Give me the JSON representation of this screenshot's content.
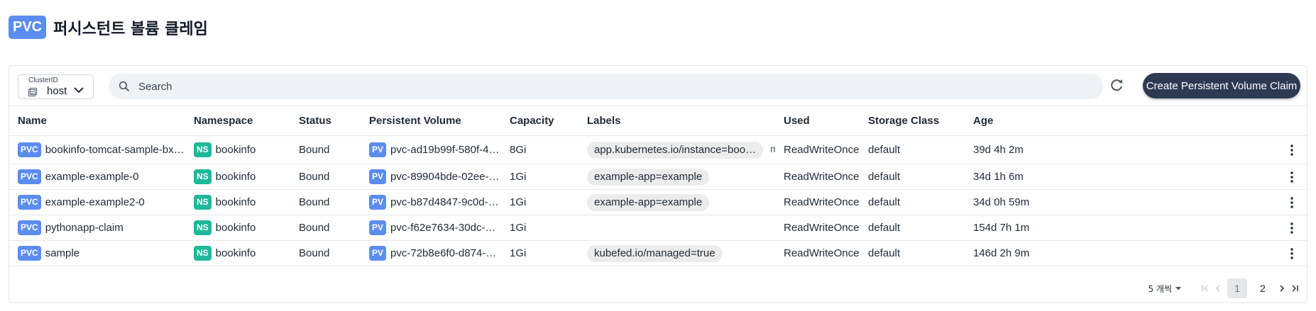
{
  "header": {
    "logo_text": "PVC",
    "title": "퍼시스턴트 볼륨 클레임"
  },
  "toolbar": {
    "cluster_caption": "ClusterID",
    "cluster_value": "host",
    "search_placeholder": "Search",
    "search_value": "",
    "create_label": "Create Persistent Volume Claim"
  },
  "table": {
    "columns": [
      "Name",
      "Namespace",
      "Status",
      "Persistent Volume",
      "Capacity",
      "Labels",
      "Used",
      "Storage Class",
      "Age"
    ],
    "rows": [
      {
        "name_tag": "PVC",
        "name": "bookinfo-tomcat-sample-bxc…",
        "ns_tag": "NS",
        "namespace": "bookinfo",
        "status": "Bound",
        "pv_tag": "PV",
        "pv": "pvc-ad19b99f-580f-494…",
        "capacity": "8Gi",
        "label": "app.kubernetes.io/instance=boo…",
        "more": "more",
        "used": "ReadWriteOnce",
        "storage_class": "default",
        "age": "39d 4h 2m"
      },
      {
        "name_tag": "PVC",
        "name": "example-example-0",
        "ns_tag": "NS",
        "namespace": "bookinfo",
        "status": "Bound",
        "pv_tag": "PV",
        "pv": "pvc-89904bde-02ee-4e…",
        "capacity": "1Gi",
        "label": "example-app=example",
        "more": "",
        "used": "ReadWriteOnce",
        "storage_class": "default",
        "age": "34d 1h 6m"
      },
      {
        "name_tag": "PVC",
        "name": "example-example2-0",
        "ns_tag": "NS",
        "namespace": "bookinfo",
        "status": "Bound",
        "pv_tag": "PV",
        "pv": "pvc-b87d4847-9c0d-4c…",
        "capacity": "1Gi",
        "label": "example-app=example",
        "more": "",
        "used": "ReadWriteOnce",
        "storage_class": "default",
        "age": "34d 0h 59m"
      },
      {
        "name_tag": "PVC",
        "name": "pythonapp-claim",
        "ns_tag": "NS",
        "namespace": "bookinfo",
        "status": "Bound",
        "pv_tag": "PV",
        "pv": "pvc-f62e7634-30dc-4f2…",
        "capacity": "1Gi",
        "label": "",
        "more": "",
        "used": "ReadWriteOnce",
        "storage_class": "default",
        "age": "154d 7h 1m"
      },
      {
        "name_tag": "PVC",
        "name": "sample",
        "ns_tag": "NS",
        "namespace": "bookinfo",
        "status": "Bound",
        "pv_tag": "PV",
        "pv": "pvc-72b8e6f0-d874-4f5…",
        "capacity": "1Gi",
        "label": "kubefed.io/managed=true",
        "more": "",
        "used": "ReadWriteOnce",
        "storage_class": "default",
        "age": "146d 2h 9m"
      }
    ]
  },
  "pagination": {
    "page_size": "5 개씩",
    "pages": [
      "1",
      "2"
    ],
    "current_page": "1"
  },
  "icons": {
    "cluster": "cluster-icon",
    "search": "search-icon",
    "refresh": "refresh-icon",
    "row_menu": "kebab-menu-icon"
  },
  "colors": {
    "accent_blue": "#5b8def",
    "namespace_green": "#1fb89a",
    "create_button": "#2d3a52",
    "search_bg": "#eef2f6"
  }
}
